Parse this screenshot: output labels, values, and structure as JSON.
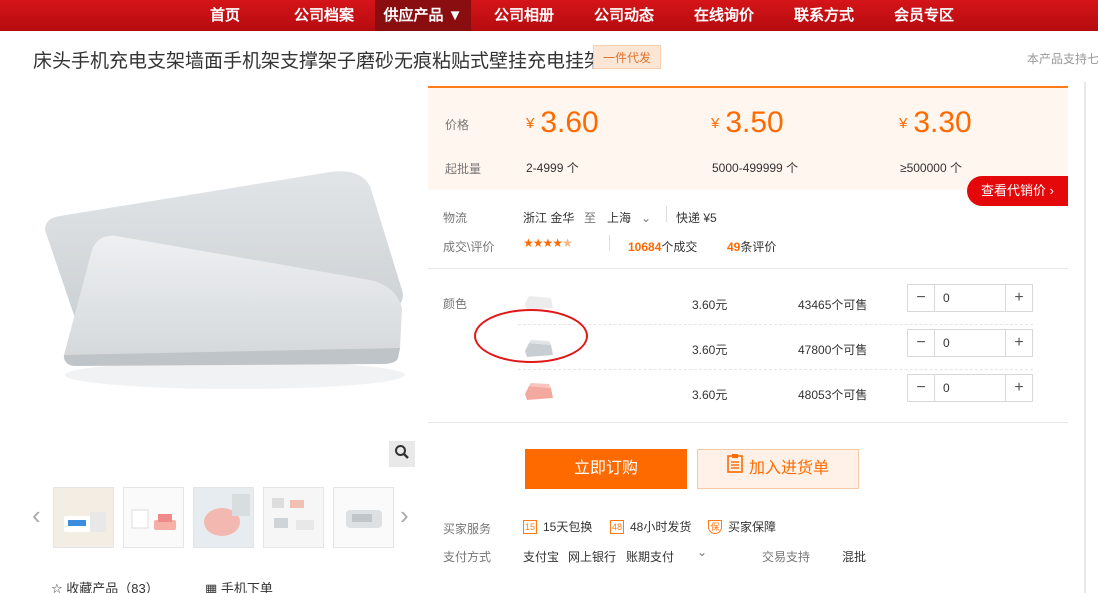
{
  "nav": {
    "items": [
      {
        "label": "首页"
      },
      {
        "label": "公司档案"
      },
      {
        "label": "供应产品 ▼"
      },
      {
        "label": "公司相册"
      },
      {
        "label": "公司动态"
      },
      {
        "label": "在线询价"
      },
      {
        "label": "联系方式"
      },
      {
        "label": "会员专区"
      }
    ]
  },
  "product": {
    "title": "床头手机充电支架墙面手机架支撑架子磨砂无痕粘贴式壁挂充电挂架",
    "tag": "一件代发",
    "support_note": "本产品支持七"
  },
  "gallery": {
    "thumbnail_count": 5,
    "favorite_label": "收藏产品（83）",
    "mobile_order_label": "手机下单"
  },
  "pricing": {
    "price_label": "价格",
    "moq_label": "起批量",
    "currency": "¥",
    "tiers": [
      {
        "price": "3.60",
        "moq": "2-4999 个"
      },
      {
        "price": "3.50",
        "moq": "5000-499999 个"
      },
      {
        "price": "3.30",
        "moq": "≥500000 个"
      }
    ],
    "agent_price_button": "查看代销价 ›"
  },
  "logistics": {
    "label": "物流",
    "from": "浙江 金华",
    "to_word": "至",
    "to": "上海",
    "express": "快递 ¥5"
  },
  "deals": {
    "label": "成交\\评价",
    "rating_stars": 4.5,
    "deal_count": "10684",
    "deal_suffix": "个成交",
    "review_count": "49",
    "review_suffix": "条评价"
  },
  "sku": {
    "label": "颜色",
    "rows": [
      {
        "color": "#f0f0f0",
        "price": "3.60元",
        "stock": "43465个可售",
        "qty": "0"
      },
      {
        "color": "#cfd4d8",
        "price": "3.60元",
        "stock": "47800个可售",
        "qty": "0"
      },
      {
        "color": "#f4a9a0",
        "price": "3.60元",
        "stock": "48053个可售",
        "qty": "0"
      }
    ]
  },
  "actions": {
    "order_now": "立即订购",
    "add_to_list": "加入进货单"
  },
  "services": {
    "label": "买家服务",
    "items": [
      {
        "icon": "15",
        "text": "15天包换"
      },
      {
        "icon": "48",
        "text": "48小时发货"
      },
      {
        "icon": "保",
        "text": "买家保障"
      }
    ]
  },
  "payment": {
    "label": "支付方式",
    "methods": [
      "支付宝",
      "网上银行",
      "账期支付"
    ],
    "trade_label": "交易支持",
    "trade_value": "混批"
  },
  "colors": {
    "nav_red": "#c81016",
    "accent_orange": "#ff6a00",
    "agent_red": "#e4080a"
  }
}
